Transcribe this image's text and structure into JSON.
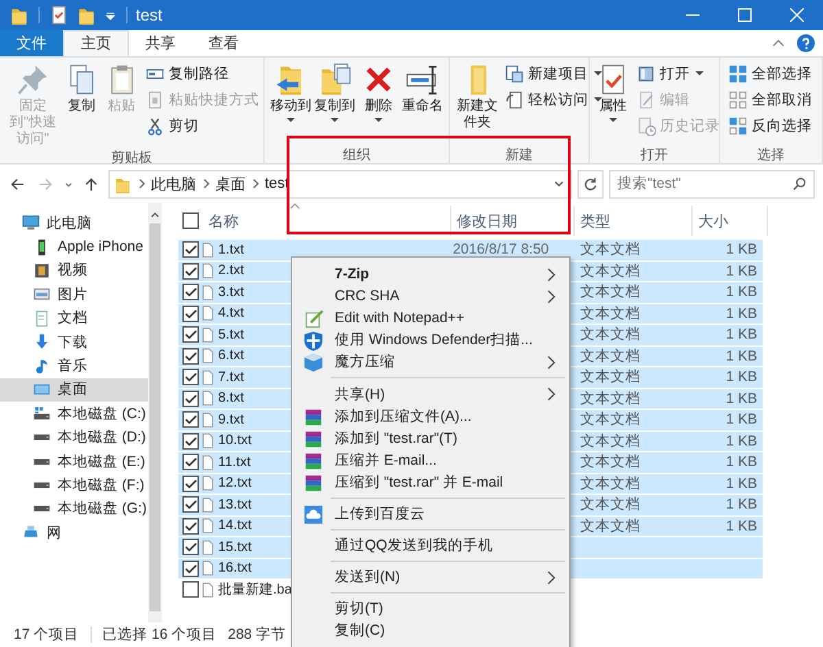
{
  "window": {
    "title": "test"
  },
  "ribbon_tabs": [
    {
      "label": "文件",
      "kind": "file",
      "selected": false
    },
    {
      "label": "主页",
      "kind": "tab",
      "selected": true
    },
    {
      "label": "共享",
      "kind": "tab",
      "selected": false
    },
    {
      "label": "查看",
      "kind": "tab",
      "selected": false
    }
  ],
  "ribbon_groups": [
    {
      "label": "剪贴板",
      "items": [
        {
          "kind": "large",
          "label": "固定到\"快速访问\"",
          "disabled": true,
          "dropdown": false
        },
        {
          "kind": "large",
          "label": "复制",
          "disabled": false,
          "dropdown": false
        },
        {
          "kind": "large",
          "label": "粘贴",
          "disabled": true,
          "dropdown": false
        },
        {
          "kind": "small",
          "label": "复制路径",
          "disabled": false,
          "dropdown": false
        },
        {
          "kind": "small",
          "label": "粘贴快捷方式",
          "disabled": true,
          "dropdown": false
        },
        {
          "kind": "small",
          "label": "剪切",
          "disabled": false,
          "dropdown": false
        }
      ]
    },
    {
      "label": "组织",
      "items": [
        {
          "kind": "large",
          "label": "移动到",
          "disabled": false,
          "dropdown": true
        },
        {
          "kind": "large",
          "label": "复制到",
          "disabled": false,
          "dropdown": true
        },
        {
          "kind": "large",
          "label": "删除",
          "disabled": false,
          "dropdown": true
        },
        {
          "kind": "large",
          "label": "重命名",
          "disabled": false,
          "dropdown": false
        }
      ]
    },
    {
      "label": "新建",
      "items": [
        {
          "kind": "large",
          "label": "新建文件夹",
          "disabled": false,
          "dropdown": false
        },
        {
          "kind": "small",
          "label": "新建项目",
          "disabled": false,
          "dropdown": true
        },
        {
          "kind": "small",
          "label": "轻松访问",
          "disabled": false,
          "dropdown": true
        }
      ]
    },
    {
      "label": "打开",
      "items": [
        {
          "kind": "large",
          "label": "属性",
          "disabled": false,
          "dropdown": true
        },
        {
          "kind": "small",
          "label": "打开",
          "disabled": false,
          "dropdown": true
        },
        {
          "kind": "small",
          "label": "编辑",
          "disabled": true,
          "dropdown": false
        },
        {
          "kind": "small",
          "label": "历史记录",
          "disabled": true,
          "dropdown": false
        }
      ]
    },
    {
      "label": "选择",
      "items": [
        {
          "kind": "small",
          "label": "全部选择",
          "disabled": false,
          "dropdown": false
        },
        {
          "kind": "small",
          "label": "全部取消",
          "disabled": false,
          "dropdown": false
        },
        {
          "kind": "small",
          "label": "反向选择",
          "disabled": false,
          "dropdown": false
        }
      ]
    }
  ],
  "address": {
    "crumbs": [
      "此电脑",
      "桌面",
      "test"
    ]
  },
  "search": {
    "placeholder": "搜索\"test\""
  },
  "sidebar": [
    {
      "label": "此电脑",
      "selected": false,
      "children": [
        {
          "label": "Apple iPhone",
          "selected": false
        },
        {
          "label": "视频",
          "selected": false
        },
        {
          "label": "图片",
          "selected": false
        },
        {
          "label": "文档",
          "selected": false
        },
        {
          "label": "下载",
          "selected": false
        },
        {
          "label": "音乐",
          "selected": false
        },
        {
          "label": "桌面",
          "selected": true
        },
        {
          "label": "本地磁盘 (C:)",
          "selected": false
        },
        {
          "label": "本地磁盘 (D:)",
          "selected": false
        },
        {
          "label": "本地磁盘 (E:)",
          "selected": false
        },
        {
          "label": "本地磁盘 (F:)",
          "selected": false
        },
        {
          "label": "本地磁盘 (G:)",
          "selected": false
        }
      ]
    },
    {
      "label": "网",
      "selected": false
    }
  ],
  "columns": [
    "名称",
    "修改日期",
    "类型",
    "大小"
  ],
  "select_all": {
    "checked": false
  },
  "rows": [
    {
      "name": "1.txt",
      "date": "2016/8/17 8:50",
      "type": "文本文档",
      "size": "1 KB",
      "checked": true,
      "selected": true
    },
    {
      "name": "2.txt",
      "type": "文本文档",
      "size": "1 KB",
      "checked": true,
      "selected": true
    },
    {
      "name": "3.txt",
      "type": "文本文档",
      "size": "1 KB",
      "checked": true,
      "selected": true
    },
    {
      "name": "4.txt",
      "type": "文本文档",
      "size": "1 KB",
      "checked": true,
      "selected": true
    },
    {
      "name": "5.txt",
      "type": "文本文档",
      "size": "1 KB",
      "checked": true,
      "selected": true
    },
    {
      "name": "6.txt",
      "type": "文本文档",
      "size": "1 KB",
      "checked": true,
      "selected": true
    },
    {
      "name": "7.txt",
      "type": "文本文档",
      "size": "1 KB",
      "checked": true,
      "selected": true
    },
    {
      "name": "8.txt",
      "type": "文本文档",
      "size": "1 KB",
      "checked": true,
      "selected": true
    },
    {
      "name": "9.txt",
      "type": "文本文档",
      "size": "1 KB",
      "checked": true,
      "selected": true
    },
    {
      "name": "10.txt",
      "type": "文本文档",
      "size": "1 KB",
      "checked": true,
      "selected": true
    },
    {
      "name": "11.txt",
      "type": "文本文档",
      "size": "1 KB",
      "checked": true,
      "selected": true
    },
    {
      "name": "12.txt",
      "type": "文本文档",
      "size": "1 KB",
      "checked": true,
      "selected": true
    },
    {
      "name": "13.txt",
      "type": "文本文档",
      "size": "1 KB",
      "checked": true,
      "selected": true
    },
    {
      "name": "14.txt",
      "type": "文本文档",
      "size": "1 KB",
      "checked": true,
      "selected": true
    },
    {
      "name": "15.txt",
      "checked": true,
      "selected": true
    },
    {
      "name": "16.txt",
      "checked": true,
      "selected": true
    },
    {
      "name": "批量新建.ba",
      "checked": false,
      "selected": false
    }
  ],
  "context_menu": [
    {
      "kind": "item",
      "label": "7-Zip",
      "bold": true,
      "submenu": true
    },
    {
      "kind": "item",
      "label": "CRC SHA",
      "bold": false,
      "submenu": true
    },
    {
      "kind": "item",
      "label": "Edit with Notepad++",
      "bold": false,
      "submenu": false
    },
    {
      "kind": "item",
      "label": "使用 Windows Defender扫描...",
      "bold": false,
      "submenu": false
    },
    {
      "kind": "item",
      "label": "魔方压缩",
      "bold": false,
      "submenu": true
    },
    {
      "kind": "separator"
    },
    {
      "kind": "item",
      "label": "共享(H)",
      "bold": false,
      "submenu": true
    },
    {
      "kind": "item",
      "label": "添加到压缩文件(A)...",
      "bold": false,
      "submenu": false
    },
    {
      "kind": "item",
      "label": "添加到 \"test.rar\"(T)",
      "bold": false,
      "submenu": false
    },
    {
      "kind": "item",
      "label": "压缩并 E-mail...",
      "bold": false,
      "submenu": false
    },
    {
      "kind": "item",
      "label": "压缩到 \"test.rar\" 并 E-mail",
      "bold": false,
      "submenu": false
    },
    {
      "kind": "separator"
    },
    {
      "kind": "item",
      "label": "上传到百度云",
      "bold": false,
      "submenu": false
    },
    {
      "kind": "separator"
    },
    {
      "kind": "item",
      "label": "通过QQ发送到我的手机",
      "bold": false,
      "submenu": false
    },
    {
      "kind": "separator"
    },
    {
      "kind": "item",
      "label": "发送到(N)",
      "bold": false,
      "submenu": true
    },
    {
      "kind": "separator"
    },
    {
      "kind": "item",
      "label": "剪切(T)",
      "bold": false,
      "submenu": false
    },
    {
      "kind": "item",
      "label": "复制(C)",
      "bold": false,
      "submenu": false
    }
  ],
  "status_bar": {
    "count": "17 个项目",
    "selection": "已选择 16 个项目",
    "size": "288 字节"
  }
}
